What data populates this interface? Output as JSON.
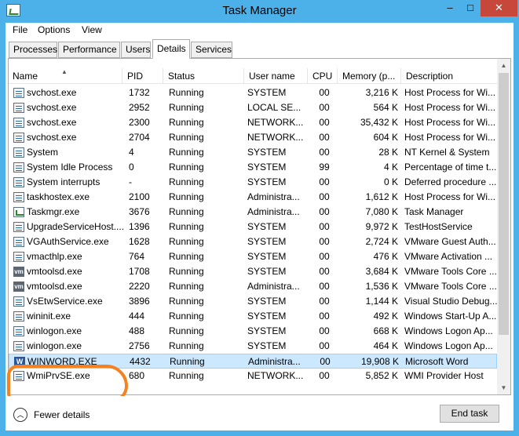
{
  "window": {
    "title": "Task Manager"
  },
  "titlebar_buttons": {
    "minimize": "–",
    "maximize": "□",
    "close": "✕"
  },
  "menu": [
    "File",
    "Options",
    "View"
  ],
  "tabs": [
    "Processes",
    "Performance",
    "Users",
    "Details",
    "Services"
  ],
  "active_tab": "Details",
  "columns": [
    "Name",
    "PID",
    "Status",
    "User name",
    "CPU",
    "Memory (p...",
    "Description"
  ],
  "rows": [
    {
      "icon": "generic-process-icon",
      "name": "svchost.exe",
      "pid": "1732",
      "status": "Running",
      "user": "SYSTEM",
      "cpu": "00",
      "mem": "3,216 K",
      "desc": "Host Process for Wi..."
    },
    {
      "icon": "generic-process-icon",
      "name": "svchost.exe",
      "pid": "2952",
      "status": "Running",
      "user": "LOCAL SE...",
      "cpu": "00",
      "mem": "564 K",
      "desc": "Host Process for Wi..."
    },
    {
      "icon": "generic-process-icon",
      "name": "svchost.exe",
      "pid": "2300",
      "status": "Running",
      "user": "NETWORK...",
      "cpu": "00",
      "mem": "35,432 K",
      "desc": "Host Process for Wi..."
    },
    {
      "icon": "generic-process-icon",
      "name": "svchost.exe",
      "pid": "2704",
      "status": "Running",
      "user": "NETWORK...",
      "cpu": "00",
      "mem": "604 K",
      "desc": "Host Process for Wi..."
    },
    {
      "icon": "generic-process-icon",
      "name": "System",
      "pid": "4",
      "status": "Running",
      "user": "SYSTEM",
      "cpu": "00",
      "mem": "28 K",
      "desc": "NT Kernel & System"
    },
    {
      "icon": "generic-process-icon",
      "name": "System Idle Process",
      "pid": "0",
      "status": "Running",
      "user": "SYSTEM",
      "cpu": "99",
      "mem": "4 K",
      "desc": "Percentage of time t..."
    },
    {
      "icon": "generic-process-icon",
      "name": "System interrupts",
      "pid": "-",
      "status": "Running",
      "user": "SYSTEM",
      "cpu": "00",
      "mem": "0 K",
      "desc": "Deferred procedure ..."
    },
    {
      "icon": "generic-process-icon",
      "name": "taskhostex.exe",
      "pid": "2100",
      "status": "Running",
      "user": "Administra...",
      "cpu": "00",
      "mem": "1,612 K",
      "desc": "Host Process for Wi..."
    },
    {
      "icon": "task-manager-icon",
      "name": "Taskmgr.exe",
      "pid": "3676",
      "status": "Running",
      "user": "Administra...",
      "cpu": "00",
      "mem": "7,080 K",
      "desc": "Task Manager"
    },
    {
      "icon": "generic-process-icon",
      "name": "UpgradeServiceHost....",
      "pid": "1396",
      "status": "Running",
      "user": "SYSTEM",
      "cpu": "00",
      "mem": "9,972 K",
      "desc": "TestHostService"
    },
    {
      "icon": "generic-process-icon",
      "name": "VGAuthService.exe",
      "pid": "1628",
      "status": "Running",
      "user": "SYSTEM",
      "cpu": "00",
      "mem": "2,724 K",
      "desc": "VMware Guest Auth..."
    },
    {
      "icon": "generic-process-icon",
      "name": "vmacthlp.exe",
      "pid": "764",
      "status": "Running",
      "user": "SYSTEM",
      "cpu": "00",
      "mem": "476 K",
      "desc": "VMware Activation ..."
    },
    {
      "icon": "vmware-icon",
      "name": "vmtoolsd.exe",
      "pid": "1708",
      "status": "Running",
      "user": "SYSTEM",
      "cpu": "00",
      "mem": "3,684 K",
      "desc": "VMware Tools Core ..."
    },
    {
      "icon": "vmware-icon",
      "name": "vmtoolsd.exe",
      "pid": "2220",
      "status": "Running",
      "user": "Administra...",
      "cpu": "00",
      "mem": "1,536 K",
      "desc": "VMware Tools Core ..."
    },
    {
      "icon": "generic-process-icon",
      "name": "VsEtwService.exe",
      "pid": "3896",
      "status": "Running",
      "user": "SYSTEM",
      "cpu": "00",
      "mem": "1,144 K",
      "desc": "Visual Studio Debug..."
    },
    {
      "icon": "generic-process-icon",
      "name": "wininit.exe",
      "pid": "444",
      "status": "Running",
      "user": "SYSTEM",
      "cpu": "00",
      "mem": "492 K",
      "desc": "Windows Start-Up A..."
    },
    {
      "icon": "generic-process-icon",
      "name": "winlogon.exe",
      "pid": "488",
      "status": "Running",
      "user": "SYSTEM",
      "cpu": "00",
      "mem": "668 K",
      "desc": "Windows Logon Ap..."
    },
    {
      "icon": "generic-process-icon",
      "name": "winlogon.exe",
      "pid": "2756",
      "status": "Running",
      "user": "SYSTEM",
      "cpu": "00",
      "mem": "464 K",
      "desc": "Windows Logon Ap..."
    },
    {
      "icon": "word-icon",
      "name": "WINWORD.EXE",
      "pid": "4432",
      "status": "Running",
      "user": "Administra...",
      "cpu": "00",
      "mem": "19,908 K",
      "desc": "Microsoft Word",
      "selected": true
    },
    {
      "icon": "generic-process-icon",
      "name": "WmiPrvSE.exe",
      "pid": "680",
      "status": "Running",
      "user": "NETWORK...",
      "cpu": "00",
      "mem": "5,852 K",
      "desc": "WMI Provider Host"
    }
  ],
  "footer": {
    "fewer_details": "Fewer details",
    "end_task": "End task"
  },
  "colors": {
    "title_bar": "#4db1e9",
    "selected_row": "#cce8ff",
    "annotation_circle": "#f58220",
    "close_button": "#c7483a"
  }
}
